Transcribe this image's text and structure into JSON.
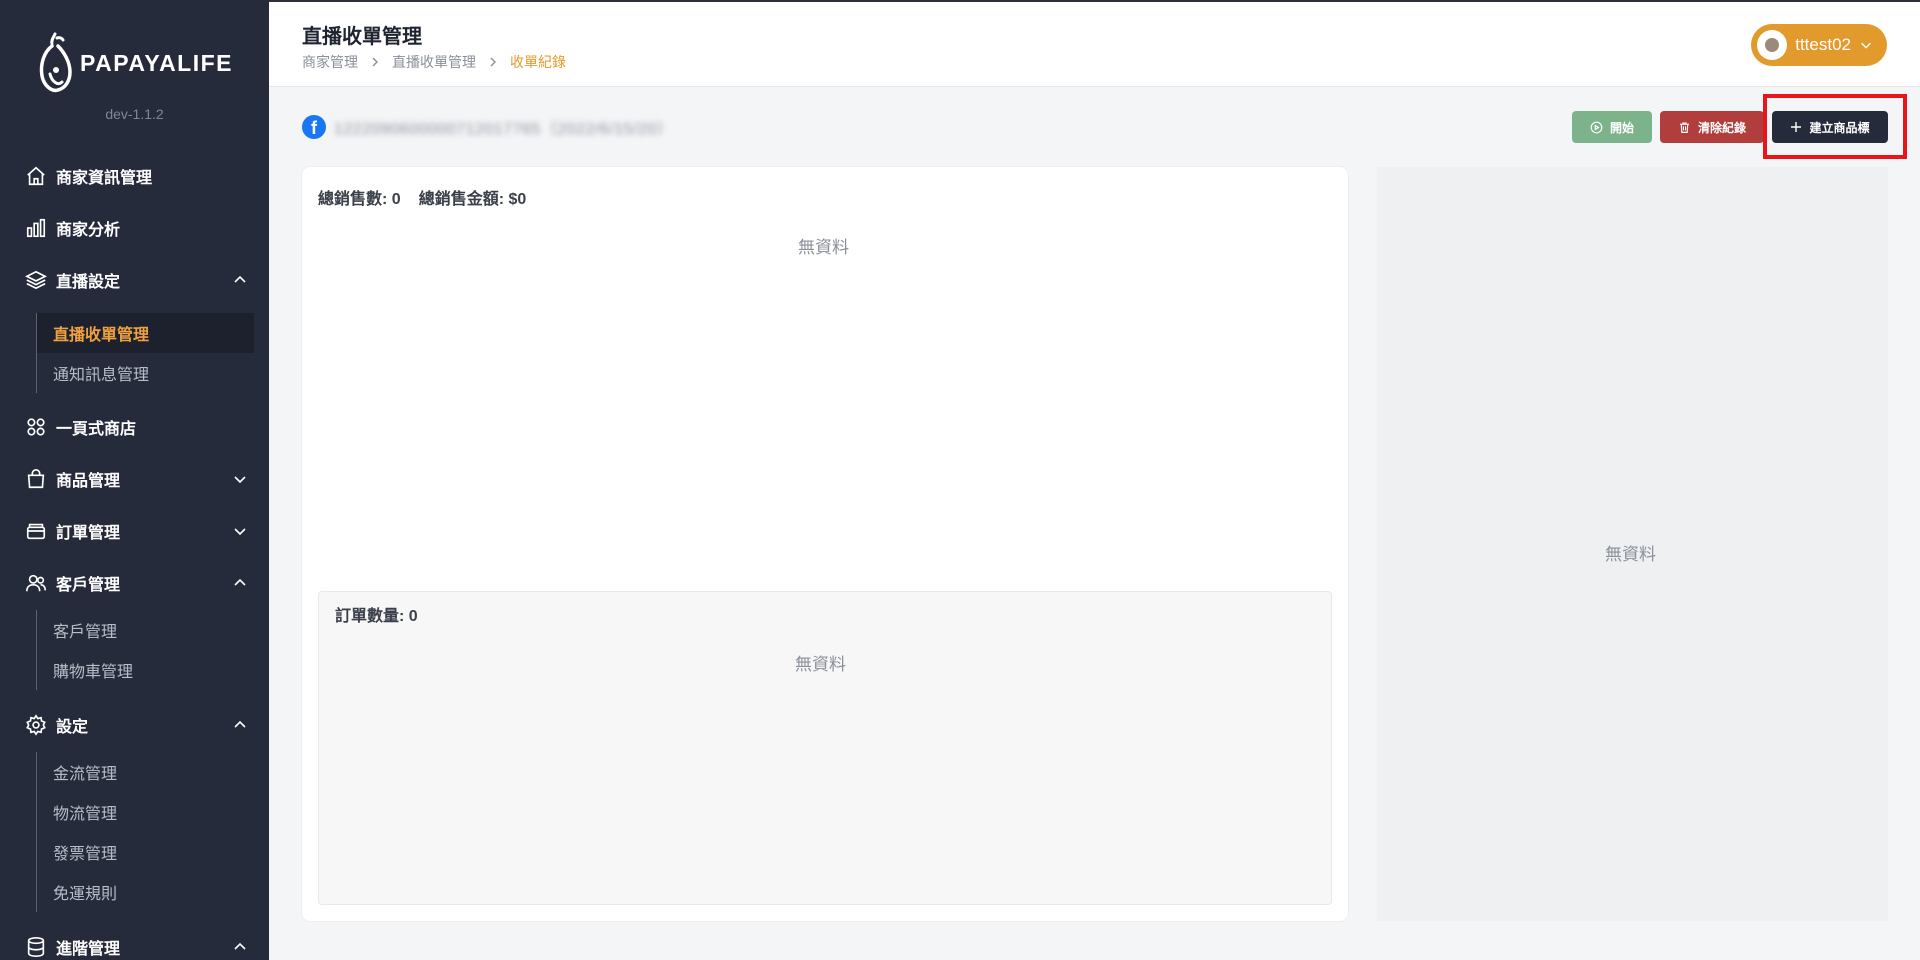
{
  "sidebar": {
    "logo_text": "PAPAYALIFE",
    "version": "dev-1.1.2",
    "items": [
      {
        "label": "商家資訊管理",
        "icon": "home-icon"
      },
      {
        "label": "商家分析",
        "icon": "bar-chart-icon"
      },
      {
        "label": "直播設定",
        "icon": "layers-icon",
        "expanded": true,
        "children": [
          {
            "label": "直播收單管理",
            "active": true
          },
          {
            "label": "通知訊息管理"
          }
        ]
      },
      {
        "label": "一頁式商店",
        "icon": "grid-icon"
      },
      {
        "label": "商品管理",
        "icon": "shopping-bag-icon",
        "expanded": false
      },
      {
        "label": "訂單管理",
        "icon": "inbox-icon",
        "expanded": false
      },
      {
        "label": "客戶管理",
        "icon": "users-icon",
        "expanded": true,
        "children": [
          {
            "label": "客戶管理"
          },
          {
            "label": "購物車管理"
          }
        ]
      },
      {
        "label": "設定",
        "icon": "gear-icon",
        "expanded": true,
        "children": [
          {
            "label": "金流管理"
          },
          {
            "label": "物流管理"
          },
          {
            "label": "發票管理"
          },
          {
            "label": "免運規則"
          }
        ]
      },
      {
        "label": "進階管理",
        "icon": "database-icon",
        "expanded": true
      }
    ]
  },
  "header": {
    "title": "直播收單管理",
    "breadcrumb": [
      "商家管理",
      "直播收單管理",
      "收單紀錄"
    ],
    "username": "tttest02"
  },
  "source": {
    "text": "1222090600000712017765（2022/6/15/20）",
    "icon": "facebook-icon"
  },
  "actions": {
    "start": "開始",
    "clear": "清除紀錄",
    "create": "建立商品標"
  },
  "summary": {
    "total_sales_count": "總銷售數: 0",
    "total_sales_amount": "總銷售金額: $0",
    "no_data": "無資料"
  },
  "orders": {
    "count_label": "訂單數量: 0",
    "no_data": "無資料"
  },
  "side_panel": {
    "no_data": "無資料"
  },
  "colors": {
    "sidebar_bg": "#252b3a",
    "accent": "#e39a2d",
    "start_btn": "#7db38a",
    "clear_btn": "#b13d3d",
    "highlight": "#e8161b"
  }
}
